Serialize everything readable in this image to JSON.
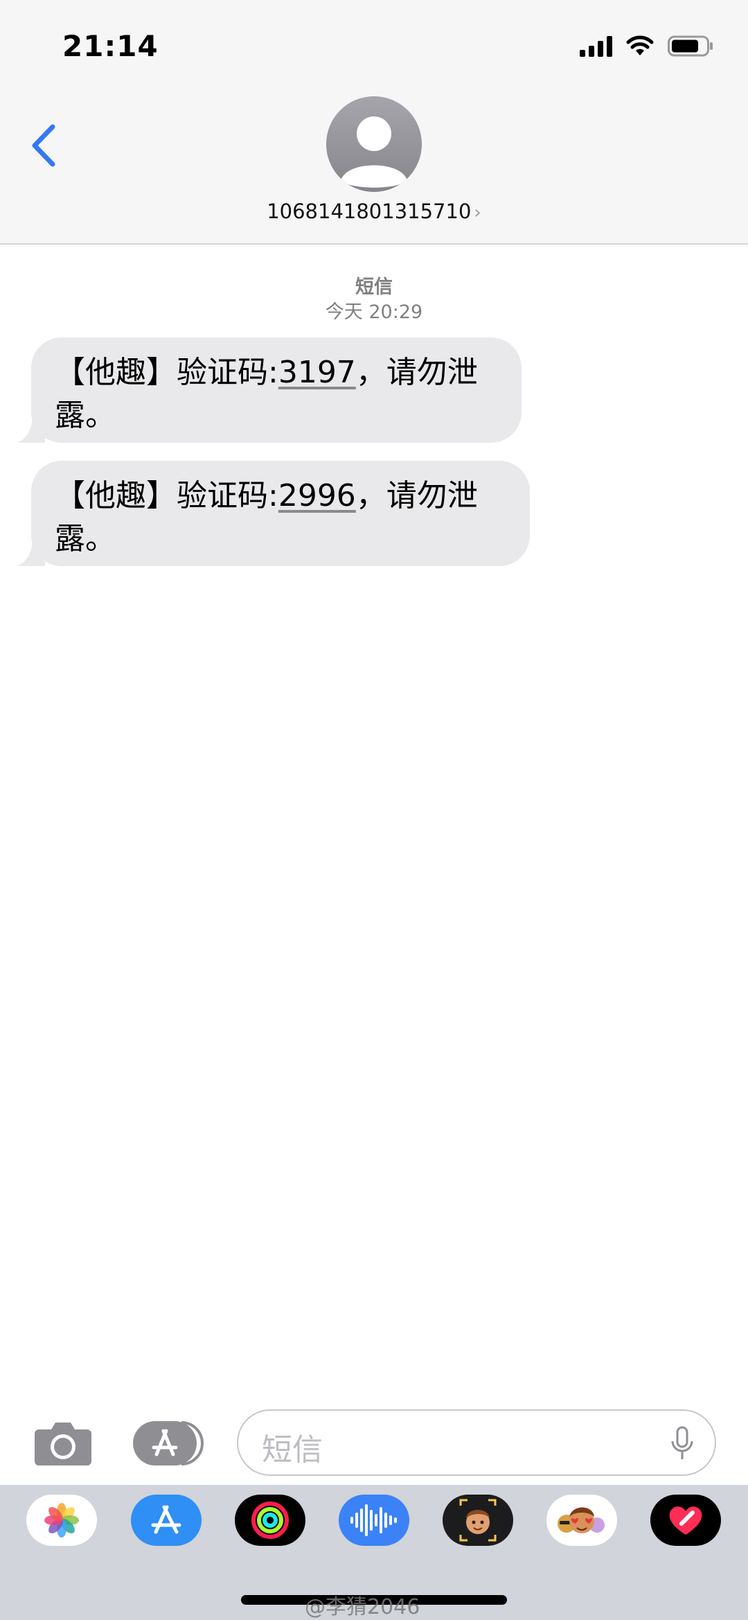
{
  "status_bar": {
    "time": "21:14"
  },
  "header": {
    "contact": "1068141801315710",
    "chevron": "›"
  },
  "thread": {
    "label": "短信",
    "timestamp": "今天 20:29",
    "messages": [
      {
        "prefix": "【他趣】验证码:",
        "code": "3197",
        "suffix": "，请勿泄",
        "line2": "露。"
      },
      {
        "prefix": "【他趣】验证码:",
        "code": "2996",
        "suffix": "，请勿泄",
        "line2": "露。"
      }
    ]
  },
  "input": {
    "placeholder": "短信"
  },
  "app_drawer": {
    "apps": [
      "photos-icon",
      "app-store-icon",
      "activity-icon",
      "audio-icon",
      "memoji-icon",
      "memoji-stickers-icon",
      "digital-touch-icon"
    ]
  },
  "watermark": "@李猜2046",
  "colors": {
    "accent": "#3478f6",
    "bubble": "#e9e9eb",
    "header_bg": "#f6f6f6",
    "drawer_bg": "#d1d4da"
  }
}
